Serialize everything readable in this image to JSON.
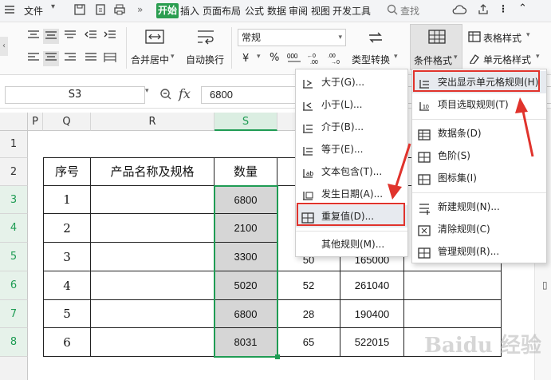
{
  "menubar": {
    "file": "文件",
    "more": "»",
    "tabs": [
      "开始",
      "插入",
      "页面布局",
      "公式",
      "数据",
      "审阅",
      "视图",
      "开发工具"
    ],
    "search": "查找"
  },
  "ribbon": {
    "merge_center": "合并居中",
    "wrap_text": "自动换行",
    "number_format": "常规",
    "type_convert": "类型转换",
    "conditional_format": "条件格式",
    "table_style": "表格样式",
    "cell_style": "单元格样式",
    "currency_symbol": "¥",
    "percent_symbol": "%"
  },
  "formula_bar": {
    "cell_ref": "S3",
    "fx": "fx",
    "value": "6800"
  },
  "grid": {
    "columns": [
      "P",
      "Q",
      "R",
      "S"
    ],
    "rows": [
      "1",
      "2",
      "3",
      "4",
      "5",
      "6",
      "7",
      "8"
    ],
    "headers": [
      "序号",
      "产品名称及规格",
      "数量"
    ],
    "seq": [
      "1",
      "2",
      "3",
      "4",
      "5",
      "6"
    ],
    "qty": [
      "6800",
      "2100",
      "3300",
      "5020",
      "6800",
      "8031"
    ],
    "partial_col_t": [
      "50",
      "52",
      "50",
      "28",
      "65"
    ],
    "partial_col_u": [
      "165000",
      "261040",
      "190400",
      "522015"
    ]
  },
  "submenu_left": {
    "items": [
      "大于(G)...",
      "小于(L)...",
      "介于(B)...",
      "等于(E)...",
      "文本包含(T)...",
      "发生日期(A)...",
      "重复值(D)...",
      "其他规则(M)..."
    ]
  },
  "submenu_right": {
    "items": [
      "突出显示单元格规则(H)",
      "项目选取规则(T)",
      "数据条(D)",
      "色阶(S)",
      "图标集(I)",
      "新建规则(N)...",
      "清除规则(C)",
      "管理规则(R)..."
    ]
  },
  "watermark": "Baidu 经验",
  "colors": {
    "accent_green": "#2a9d50",
    "selection_green": "#1f9c54",
    "highlight_red": "#e0332c",
    "selected_fill": "#d6d6d6"
  }
}
